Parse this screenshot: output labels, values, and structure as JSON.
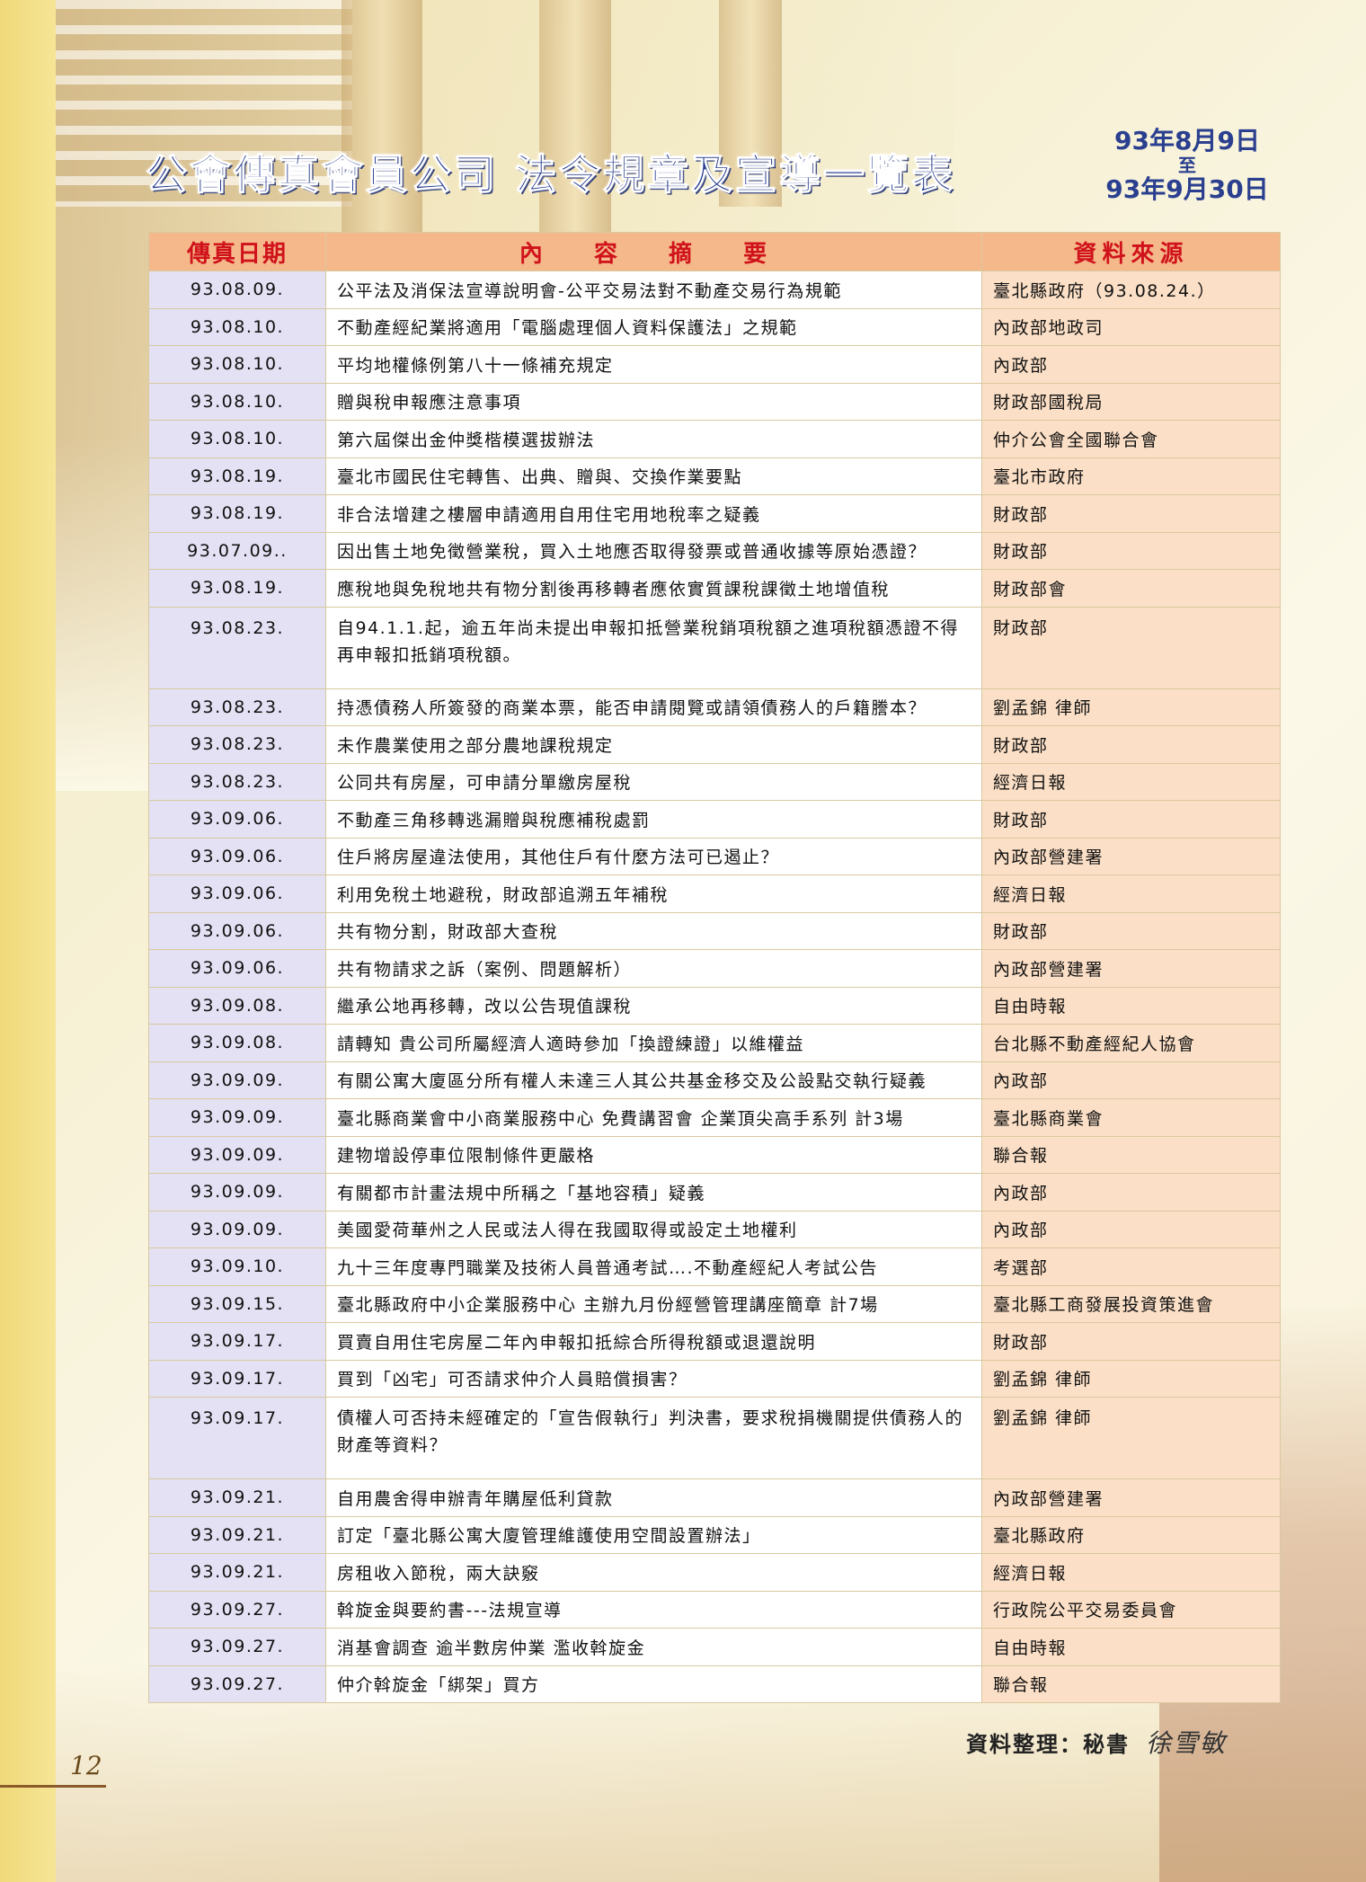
{
  "header": {
    "title": "公會傳真會員公司  法令規章及宣導一覽表",
    "date_from": "93年8月9日",
    "date_to_label": "至",
    "date_to": "93年9月30日"
  },
  "table": {
    "columns": [
      "傳真日期",
      "內 容 摘 要",
      "資料來源"
    ],
    "rows": [
      {
        "date": "93.08.09.",
        "content": "公平法及消保法宣導說明會-公平交易法對不動產交易行為規範",
        "source": "臺北縣政府（93.08.24.）"
      },
      {
        "date": "93.08.10.",
        "content": "不動產經紀業將適用「電腦處理個人資料保護法」之規範",
        "source": "內政部地政司"
      },
      {
        "date": "93.08.10.",
        "content": "平均地權條例第八十一條補充規定",
        "source": "內政部"
      },
      {
        "date": "93.08.10.",
        "content": "贈與稅申報應注意事項",
        "source": "財政部國稅局"
      },
      {
        "date": "93.08.10.",
        "content": "第六屆傑出金仲獎楷模選拔辦法",
        "source": "仲介公會全國聯合會"
      },
      {
        "date": "93.08.19.",
        "content": "臺北市國民住宅轉售、出典、贈與、交換作業要點",
        "source": "臺北市政府"
      },
      {
        "date": "93.08.19.",
        "content": "非合法增建之樓層申請適用自用住宅用地稅率之疑義",
        "source": "財政部"
      },
      {
        "date": "93.07.09..",
        "content": "因出售土地免徵營業稅，買入土地應否取得發票或普通收據等原始憑證？",
        "source": "財政部"
      },
      {
        "date": "93.08.19.",
        "content": "應稅地與免稅地共有物分割後再移轉者應依實質課稅課徵土地增值稅",
        "source": "財政部會"
      },
      {
        "date": "93.08.23.",
        "content": "自94.1.1.起，逾五年尚未提出申報扣抵營業稅銷項稅額之進項稅額憑證不得再申報扣抵銷項稅額。",
        "source": "財政部",
        "tall": true
      },
      {
        "date": "93.08.23.",
        "content": "持憑債務人所簽發的商業本票，能否申請閱覽或請領債務人的戶籍謄本？",
        "source": "劉孟錦 律師"
      },
      {
        "date": "93.08.23.",
        "content": "未作農業使用之部分農地課稅規定",
        "source": "財政部"
      },
      {
        "date": "93.08.23.",
        "content": "公同共有房屋，可申請分單繳房屋稅",
        "source": "經濟日報"
      },
      {
        "date": "93.09.06.",
        "content": "不動產三角移轉逃漏贈與稅應補稅處罰",
        "source": "財政部"
      },
      {
        "date": "93.09.06.",
        "content": "住戶將房屋違法使用，其他住戶有什麼方法可已遏止？",
        "source": "內政部營建署"
      },
      {
        "date": "93.09.06.",
        "content": "利用免稅土地避稅，財政部追溯五年補稅",
        "source": "經濟日報"
      },
      {
        "date": "93.09.06.",
        "content": "共有物分割，財政部大查稅",
        "source": "財政部"
      },
      {
        "date": "93.09.06.",
        "content": "共有物請求之訴（案例、問題解析）",
        "source": "內政部營建署"
      },
      {
        "date": "93.09.08.",
        "content": "繼承公地再移轉，改以公告現值課稅",
        "source": "自由時報"
      },
      {
        "date": "93.09.08.",
        "content": "請轉知 貴公司所屬經濟人適時參加「換證練證」以維權益",
        "source": "台北縣不動產經紀人協會"
      },
      {
        "date": "93.09.09.",
        "content": "有關公寓大廈區分所有權人未達三人其公共基金移交及公設點交執行疑義",
        "source": "內政部"
      },
      {
        "date": "93.09.09.",
        "content": "臺北縣商業會中小商業服務中心 免費講習會 企業頂尖高手系列 計3場",
        "source": "臺北縣商業會"
      },
      {
        "date": "93.09.09.",
        "content": "建物增設停車位限制條件更嚴格",
        "source": "聯合報"
      },
      {
        "date": "93.09.09.",
        "content": "有關都市計畫法規中所稱之「基地容積」疑義",
        "source": "內政部"
      },
      {
        "date": "93.09.09.",
        "content": "美國愛荷華州之人民或法人得在我國取得或設定土地權利",
        "source": "內政部"
      },
      {
        "date": "93.09.10.",
        "content": "九十三年度專門職業及技術人員普通考試….不動產經紀人考試公告",
        "source": "考選部"
      },
      {
        "date": "93.09.15.",
        "content": "臺北縣政府中小企業服務中心 主辦九月份經營管理講座簡章 計7場",
        "source": "臺北縣工商發展投資策進會"
      },
      {
        "date": "93.09.17.",
        "content": "買賣自用住宅房屋二年內申報扣抵綜合所得稅額或退還說明",
        "source": "財政部"
      },
      {
        "date": "93.09.17.",
        "content": "買到「凶宅」可否請求仲介人員賠償損害？",
        "source": "劉孟錦 律師"
      },
      {
        "date": "93.09.17.",
        "content": "債權人可否持未經確定的「宣告假執行」判決書，要求稅捐機關提供債務人的財產等資料？",
        "source": "劉孟錦 律師",
        "tall": true
      },
      {
        "date": "93.09.21.",
        "content": "自用農舍得申辦青年購屋低利貸款",
        "source": "內政部營建署"
      },
      {
        "date": "93.09.21.",
        "content": "訂定「臺北縣公寓大廈管理維護使用空間設置辦法」",
        "source": "臺北縣政府"
      },
      {
        "date": "93.09.21.",
        "content": "房租收入節稅，兩大訣竅",
        "source": "經濟日報"
      },
      {
        "date": "93.09.27.",
        "content": "斡旋金與要約書---法規宣導",
        "source": "行政院公平交易委員會"
      },
      {
        "date": "93.09.27.",
        "content": "消基會調查 逾半數房仲業 濫收斡旋金",
        "source": "自由時報"
      },
      {
        "date": "93.09.27.",
        "content": "仲介斡旋金「綁架」買方",
        "source": "聯合報"
      }
    ]
  },
  "footer": {
    "compiled_by": "資料整理：秘書",
    "signature": "徐雪敏",
    "page_number": "12"
  }
}
